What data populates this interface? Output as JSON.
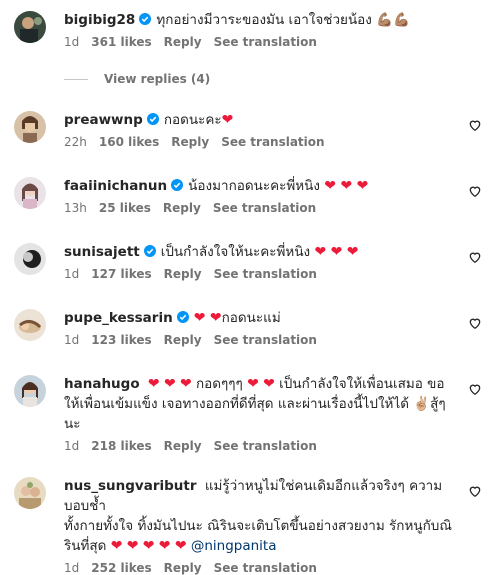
{
  "colors": {
    "accent": "#0095f6",
    "heart": "#ed1a3a",
    "muted": "#737373"
  },
  "comments": [
    {
      "username": "bigibig28",
      "verified": true,
      "text": "ทุกอย่างมีวาระของมัน เอาใจช่วยน้อง",
      "emoji": "💪🏽💪🏽",
      "time": "1d",
      "likes": "361 likes",
      "reply": "Reply",
      "see": "See translation",
      "view_replies": "View replies (4)"
    },
    {
      "username": "preawwnp",
      "verified": true,
      "text": "กอดนะคะ",
      "emoji": "❤",
      "time": "22h",
      "likes": "160 likes",
      "reply": "Reply",
      "see": "See translation"
    },
    {
      "username": "faaiinichanun",
      "verified": true,
      "text": "น้องมากอดนะคะพี่หนิง",
      "emoji": "❤ ❤ ❤",
      "time": "13h",
      "likes": "25 likes",
      "reply": "Reply",
      "see": "See translation"
    },
    {
      "username": "sunisajett",
      "verified": true,
      "text": "เป็นกำลังใจให้นะคะพี่หนิง",
      "emoji": "❤ ❤ ❤",
      "time": "1d",
      "likes": "127 likes",
      "reply": "Reply",
      "see": "See translation"
    },
    {
      "username": "pupe_kessarin",
      "verified": true,
      "emoji": "❤ ❤",
      "text": "กอดนะแม่",
      "time": "1d",
      "likes": "123 likes",
      "reply": "Reply",
      "see": "See translation"
    },
    {
      "username": "hanahugo",
      "verified": false,
      "line1": "❤ ❤ ❤ กอดๆๆๆ ❤ ❤ เป็นกำลังใจให้เพื่อนเสมอ ขอ",
      "line2": "ให้เพื่อนเข้มแข็ง เจอทางออกที่ดีที่สุด และผ่านเรื่องนี้ไปให้ได้ ✌🏼สู้ๆ",
      "line3": "นะ",
      "time": "1d",
      "likes": "218 likes",
      "reply": "Reply",
      "see": "See translation"
    },
    {
      "username": "nus_sungvaributr",
      "verified": false,
      "line1": "แม่รู้ว่าหนูไม่ใช่คนเดิมอีกแล้วจริงๆ ความบอบช้ำ",
      "line2": "ทั้งกายทั้งใจ ทิ้งมันไปนะ ณิรินจะเติบโตขึ้นอย่างสวยงาม รักหนูกับณิ",
      "line3": "รินที่สุด ❤ ❤ ❤ ❤ ❤",
      "mention": "@ningpanita",
      "time": "1d",
      "likes": "252 likes",
      "reply": "Reply",
      "see": "See translation"
    }
  ]
}
